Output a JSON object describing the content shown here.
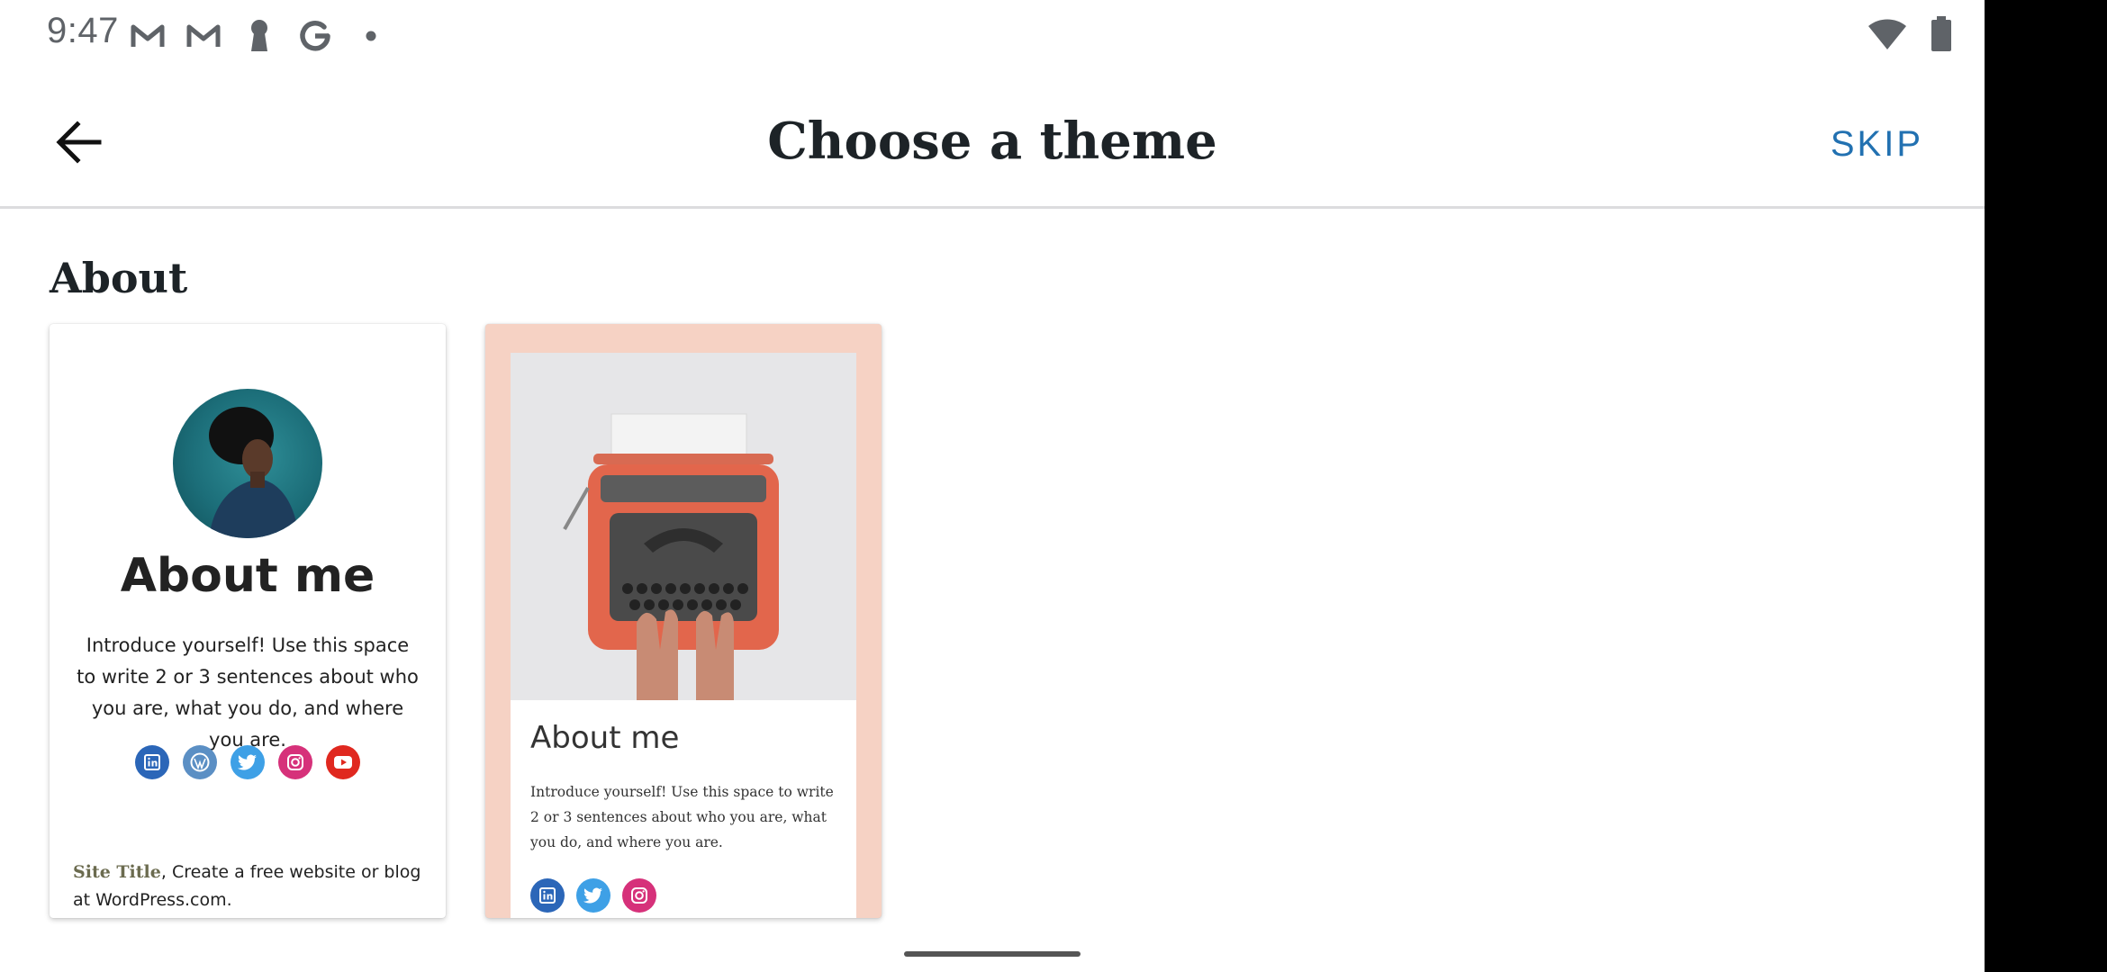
{
  "status_bar": {
    "time": "9:47",
    "left_icons": [
      "gmail-icon",
      "gmail-icon",
      "keyhole-icon",
      "google-icon",
      "dot-icon"
    ],
    "right_icons": [
      "wifi-icon",
      "battery-icon"
    ]
  },
  "app_bar": {
    "title": "Choose a theme",
    "skip_label": "SKIP",
    "back_icon": "arrow-back-icon",
    "accent_color": "#2271b1"
  },
  "section": {
    "title": "About"
  },
  "themes": [
    {
      "heading": "About me",
      "text": "Introduce yourself! Use this space to write 2 or 3 sentences about who you are, what you do, and where you are.",
      "social": [
        "linkedin-icon",
        "wordpress-icon",
        "twitter-icon",
        "instagram-icon",
        "youtube-icon"
      ],
      "footer_site_title": "Site Title",
      "footer_text": ", Create a free website or blog at WordPress.com."
    },
    {
      "heading": "About me",
      "text": "Introduce yourself! Use this space to write 2 or 3 sentences about who you are, what you do, and where you are.",
      "social": [
        "linkedin-icon",
        "twitter-icon",
        "instagram-icon"
      ],
      "background_color": "#f6d2c4"
    }
  ]
}
